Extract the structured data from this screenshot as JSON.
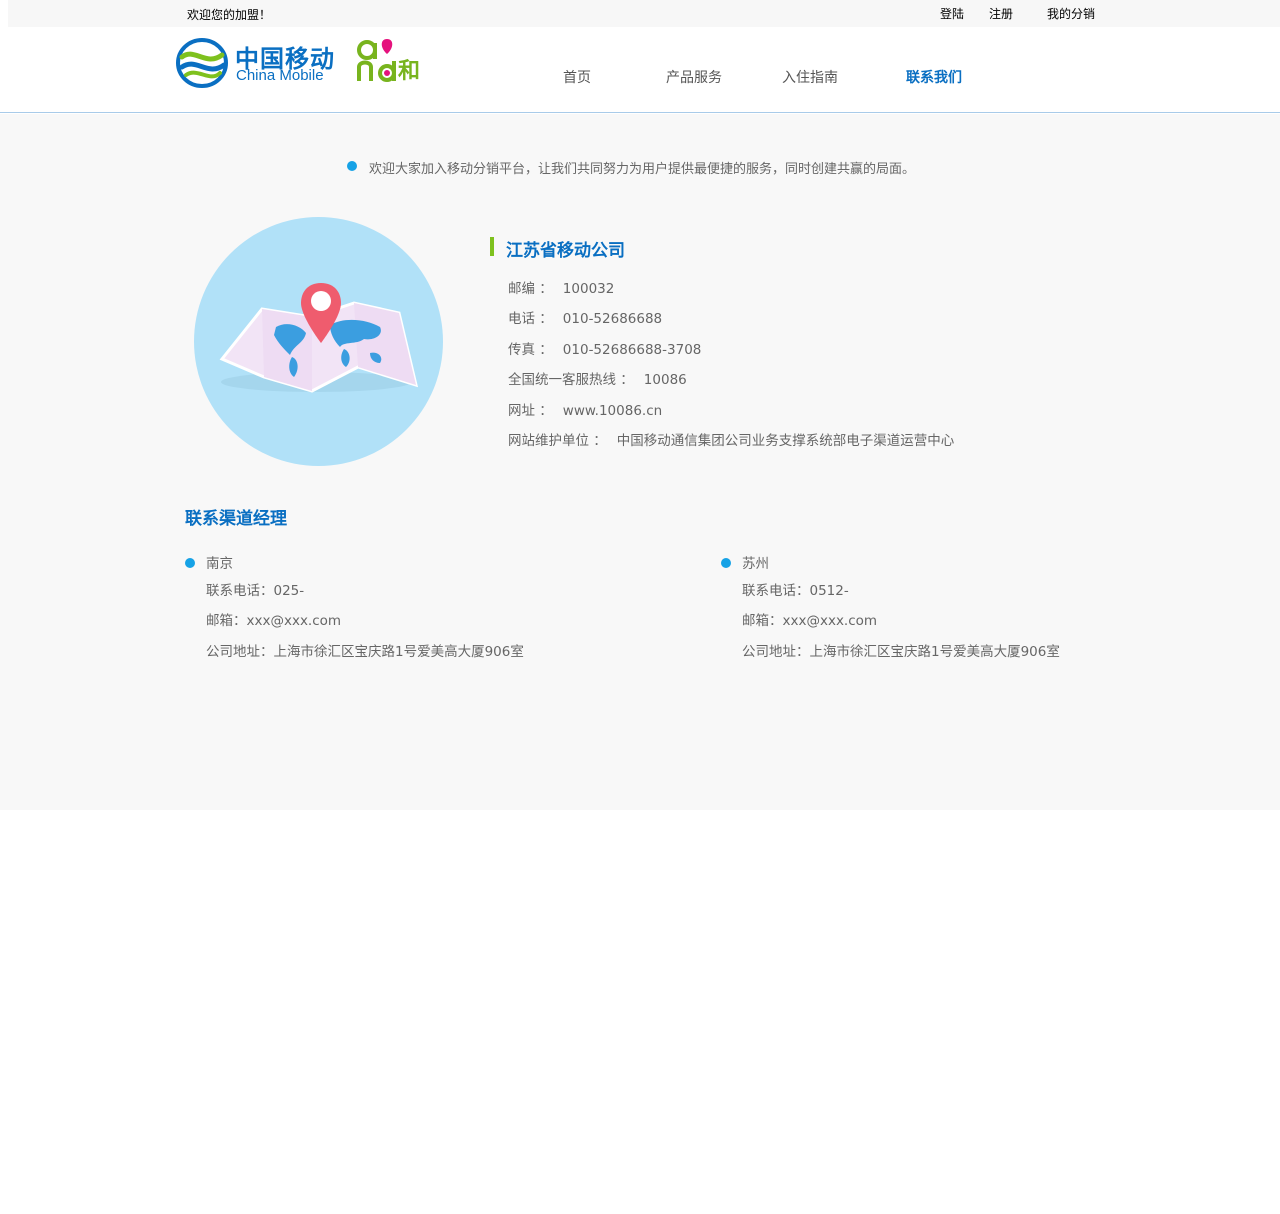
{
  "topbar": {
    "welcome": "欢迎您的加盟！",
    "login": "登陆",
    "register": "注册",
    "my_distribution": "我的分销"
  },
  "logo": {
    "cn": "中国移动",
    "en": "China Mobile",
    "and_he": "和"
  },
  "nav": {
    "items": [
      {
        "label": "首页",
        "active": false
      },
      {
        "label": "产品服务",
        "active": false
      },
      {
        "label": "入住指南",
        "active": false
      },
      {
        "label": "联系我们",
        "active": true
      }
    ]
  },
  "intro": "欢迎大家加入移动分销平台，让我们共同努力为用户提供最便捷的服务，同时创建共赢的局面。",
  "company": {
    "name": "江苏省移动公司",
    "rows": [
      {
        "label": "邮编 ：",
        "value": "100032"
      },
      {
        "label": "电话 ：",
        "value": "010-52686688"
      },
      {
        "label": "传真 ：",
        "value": "010-52686688-3708"
      },
      {
        "label": "全国统一客服热线 ：",
        "value": "10086"
      },
      {
        "label": "网址 ：",
        "value": "www.10086.cn"
      },
      {
        "label": "网站维护单位 ：",
        "value": "中国移动通信集团公司业务支撑系统部电子渠道运营中心"
      }
    ]
  },
  "managers": {
    "title": "联系渠道经理",
    "list": [
      {
        "city": "南京",
        "phone": "联系电话：025-",
        "email": "邮箱：xxx@xxx.com",
        "address": "公司地址：上海市徐汇区宝庆路1号爱美高大厦906室"
      },
      {
        "city": "苏州",
        "phone": "联系电话：0512-",
        "email": "邮箱：xxx@xxx.com",
        "address": "公司地址：上海市徐汇区宝庆路1号爱美高大厦906室"
      }
    ]
  },
  "colors": {
    "brand_blue": "#0a6fc2",
    "accent_green": "#7ec11e",
    "bullet_blue": "#16a2e6",
    "map_circle": "#b1e1f8"
  }
}
